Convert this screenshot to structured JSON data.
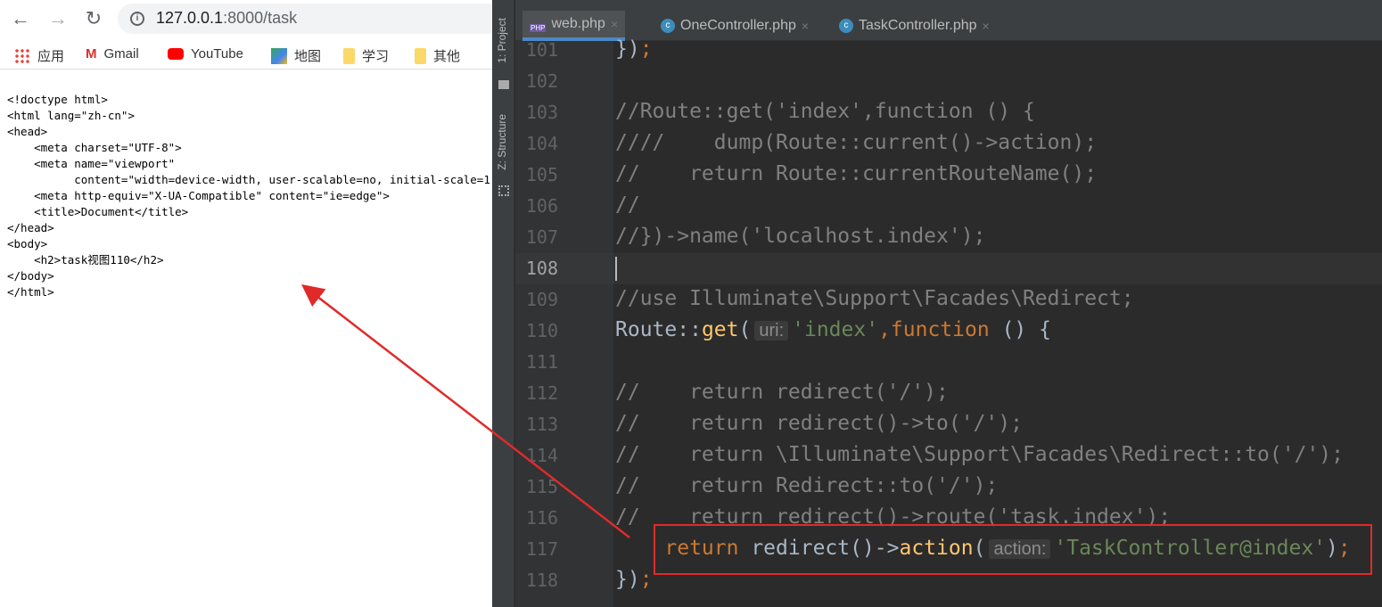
{
  "browser": {
    "url_host": "127.0.0.1",
    "url_rest": ":8000/task",
    "bookmarks": [
      {
        "label": "应用",
        "icon": "apps-grid-icon"
      },
      {
        "label": "Gmail",
        "icon": "gmail-icon"
      },
      {
        "label": "YouTube",
        "icon": "youtube-icon"
      },
      {
        "label": "地图",
        "icon": "maps-icon"
      },
      {
        "label": "学习",
        "icon": "folder-icon"
      },
      {
        "label": "其他",
        "icon": "folder-icon"
      }
    ],
    "source": "<!doctype html>\n<html lang=\"zh-cn\">\n<head>\n    <meta charset=\"UTF-8\">\n    <meta name=\"viewport\"\n          content=\"width=device-width, user-scalable=no, initial-scale=1.0\">\n    <meta http-equiv=\"X-UA-Compatible\" content=\"ie=edge\">\n    <title>Document</title>\n</head>\n<body>\n    <h2>task视图110</h2>\n</body>\n</html>"
  },
  "ide": {
    "sidebar": {
      "project": "1: Project",
      "structure": "Z: Structure"
    },
    "tabs": [
      {
        "label": "web.php",
        "icon": "php-file-icon",
        "active": true
      },
      {
        "label": "OneController.php",
        "icon": "class-icon"
      },
      {
        "label": "TaskController.php",
        "icon": "class-icon"
      }
    ],
    "current_line": 108,
    "lines": [
      {
        "n": 101,
        "tokens": [
          [
            "t",
            "})"
          ],
          [
            "k",
            ";"
          ]
        ]
      },
      {
        "n": 102,
        "tokens": []
      },
      {
        "n": 103,
        "tokens": [
          [
            "c",
            "//Route::get('index',function () {"
          ]
        ]
      },
      {
        "n": 104,
        "tokens": [
          [
            "c",
            "////    dump(Route::current()->action);"
          ]
        ]
      },
      {
        "n": 105,
        "tokens": [
          [
            "c",
            "//    return Route::currentRouteName();"
          ]
        ]
      },
      {
        "n": 106,
        "tokens": [
          [
            "c",
            "//"
          ]
        ]
      },
      {
        "n": 107,
        "tokens": [
          [
            "c",
            "//})->name('localhost.index');"
          ]
        ]
      },
      {
        "n": 108,
        "tokens": []
      },
      {
        "n": 109,
        "tokens": [
          [
            "c",
            "//use Illuminate\\Support\\Facades\\Redirect;"
          ]
        ]
      },
      {
        "n": 110,
        "tokens": [
          [
            "t",
            "Route::"
          ],
          [
            "f",
            "get"
          ],
          [
            "t",
            "("
          ],
          [
            "h",
            "uri:"
          ],
          [
            "s",
            "'index'"
          ],
          [
            "k",
            ",function "
          ],
          [
            "t",
            "() {"
          ]
        ]
      },
      {
        "n": 111,
        "tokens": []
      },
      {
        "n": 112,
        "tokens": [
          [
            "c",
            "//    return redirect('/');"
          ]
        ]
      },
      {
        "n": 113,
        "tokens": [
          [
            "c",
            "//    return redirect()->to('/');"
          ]
        ]
      },
      {
        "n": 114,
        "tokens": [
          [
            "c",
            "//    return \\Illuminate\\Support\\Facades\\Redirect::to('/');"
          ]
        ]
      },
      {
        "n": 115,
        "tokens": [
          [
            "c",
            "//    return Redirect::to('/');"
          ]
        ]
      },
      {
        "n": 116,
        "tokens": [
          [
            "c",
            "//    return redirect()->route('task.index');"
          ]
        ]
      },
      {
        "n": 117,
        "tokens": [
          [
            "t",
            "    "
          ],
          [
            "k",
            "return "
          ],
          [
            "t",
            "redirect()->"
          ],
          [
            "f",
            "action"
          ],
          [
            "t",
            "("
          ],
          [
            "h",
            "action:"
          ],
          [
            "s",
            "'TaskController@index'"
          ],
          [
            "t",
            ")"
          ],
          [
            "k",
            ";"
          ]
        ]
      },
      {
        "n": 118,
        "tokens": [
          [
            "t",
            "})"
          ],
          [
            "k",
            ";"
          ]
        ]
      }
    ]
  },
  "annotation": {
    "color": "#e02a2a"
  }
}
